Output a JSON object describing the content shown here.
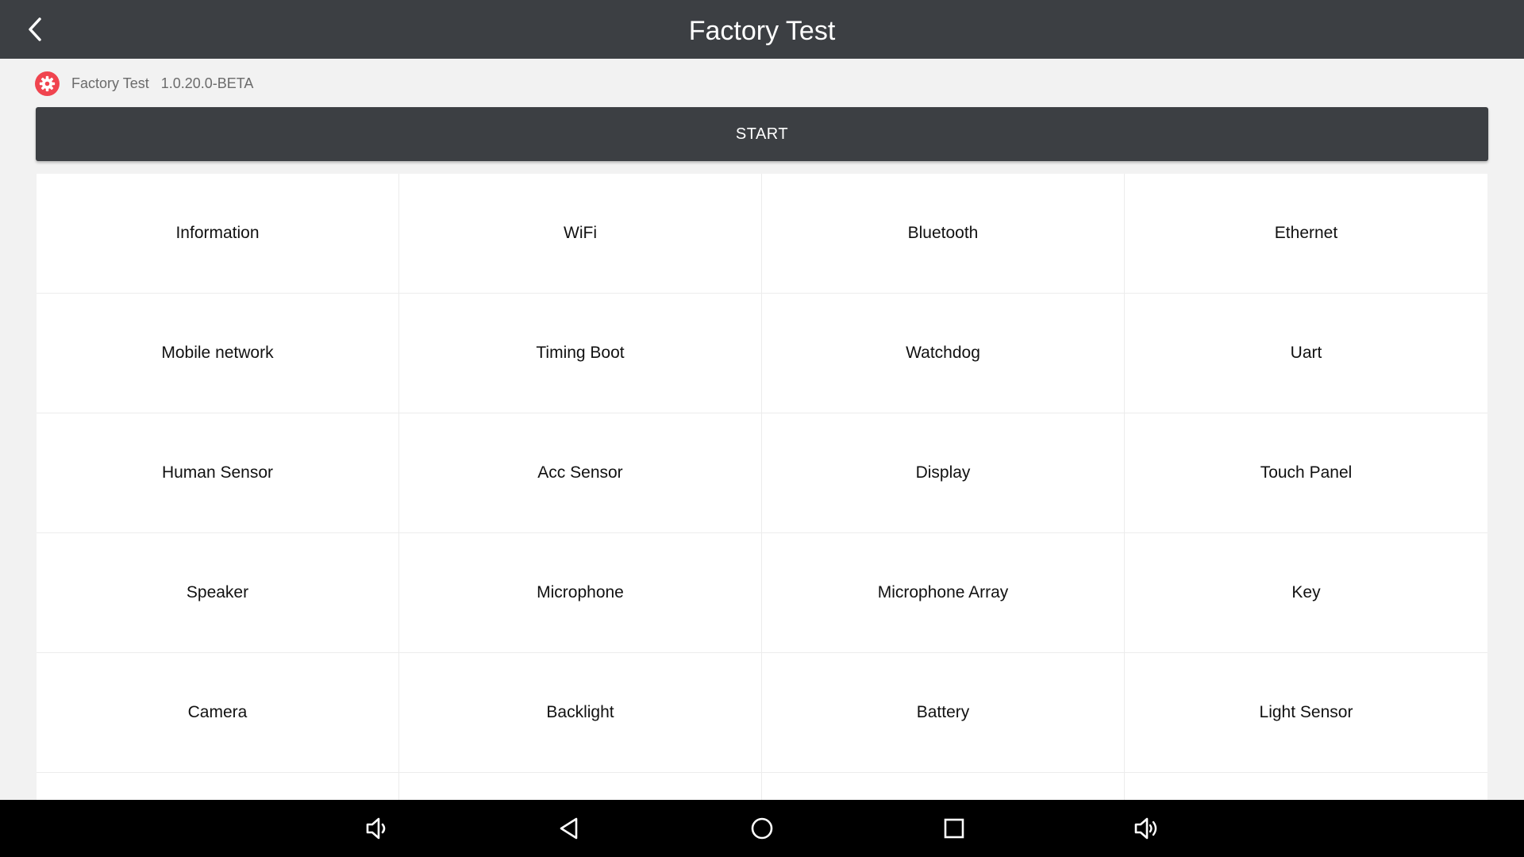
{
  "titlebar": {
    "title": "Factory Test",
    "back_icon": "chevron-left-icon"
  },
  "app_info": {
    "icon": "gear-icon",
    "icon_color": "#f0444f",
    "name": "Factory Test",
    "version": "1.0.20.0-BETA"
  },
  "start_button": {
    "label": "START"
  },
  "test_items": [
    [
      "Information",
      "WiFi",
      "Bluetooth",
      "Ethernet"
    ],
    [
      "Mobile network",
      "Timing Boot",
      "Watchdog",
      "Uart"
    ],
    [
      "Human Sensor",
      "Acc Sensor",
      "Display",
      "Touch Panel"
    ],
    [
      "Speaker",
      "Microphone",
      "Microphone Array",
      "Key"
    ],
    [
      "Camera",
      "Backlight",
      "Battery",
      "Light Sensor"
    ]
  ],
  "navbar": {
    "icons": [
      "volume-down-icon",
      "back-triangle-icon",
      "home-circle-icon",
      "recents-square-icon",
      "volume-up-icon"
    ]
  },
  "colors": {
    "header_bg": "#3c3f43",
    "page_bg": "#f2f2f2",
    "navbar_bg": "#000000"
  }
}
